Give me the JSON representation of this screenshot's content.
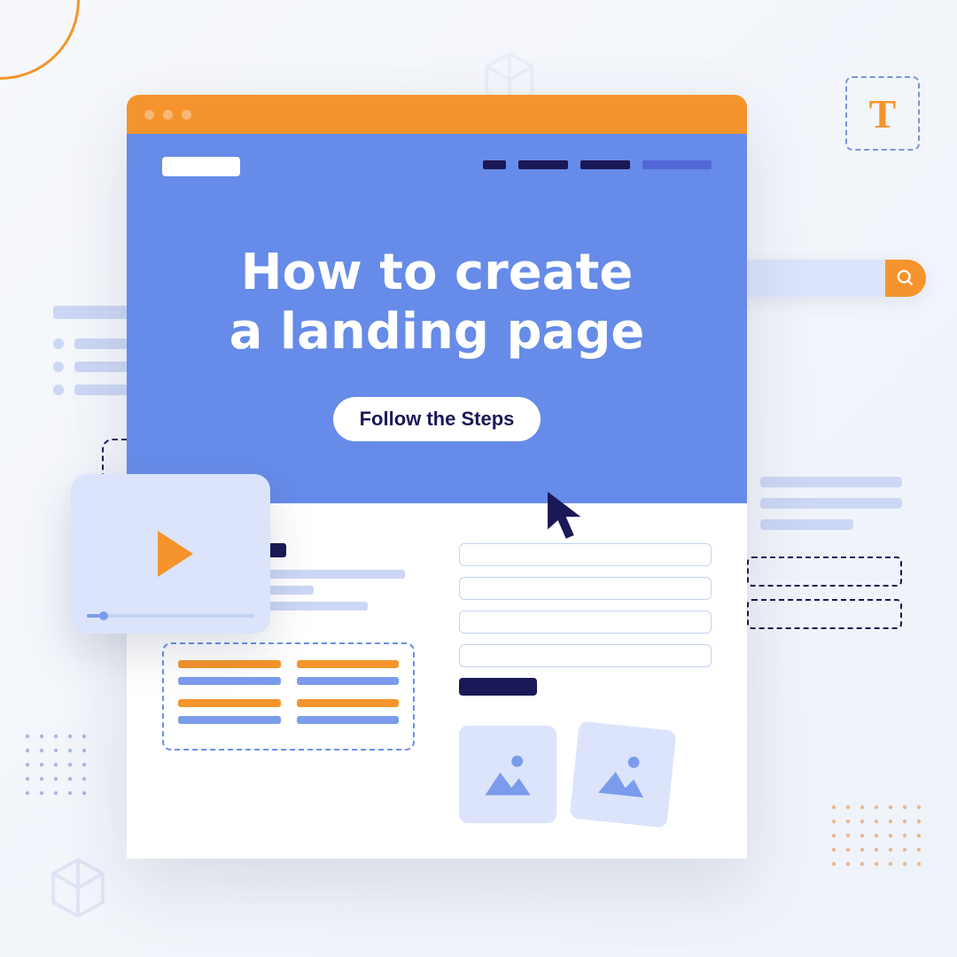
{
  "typography_box_letter": "T",
  "hero": {
    "title_line1": "How to create",
    "title_line2": "a landing page",
    "cta_label": "Follow the Steps"
  }
}
